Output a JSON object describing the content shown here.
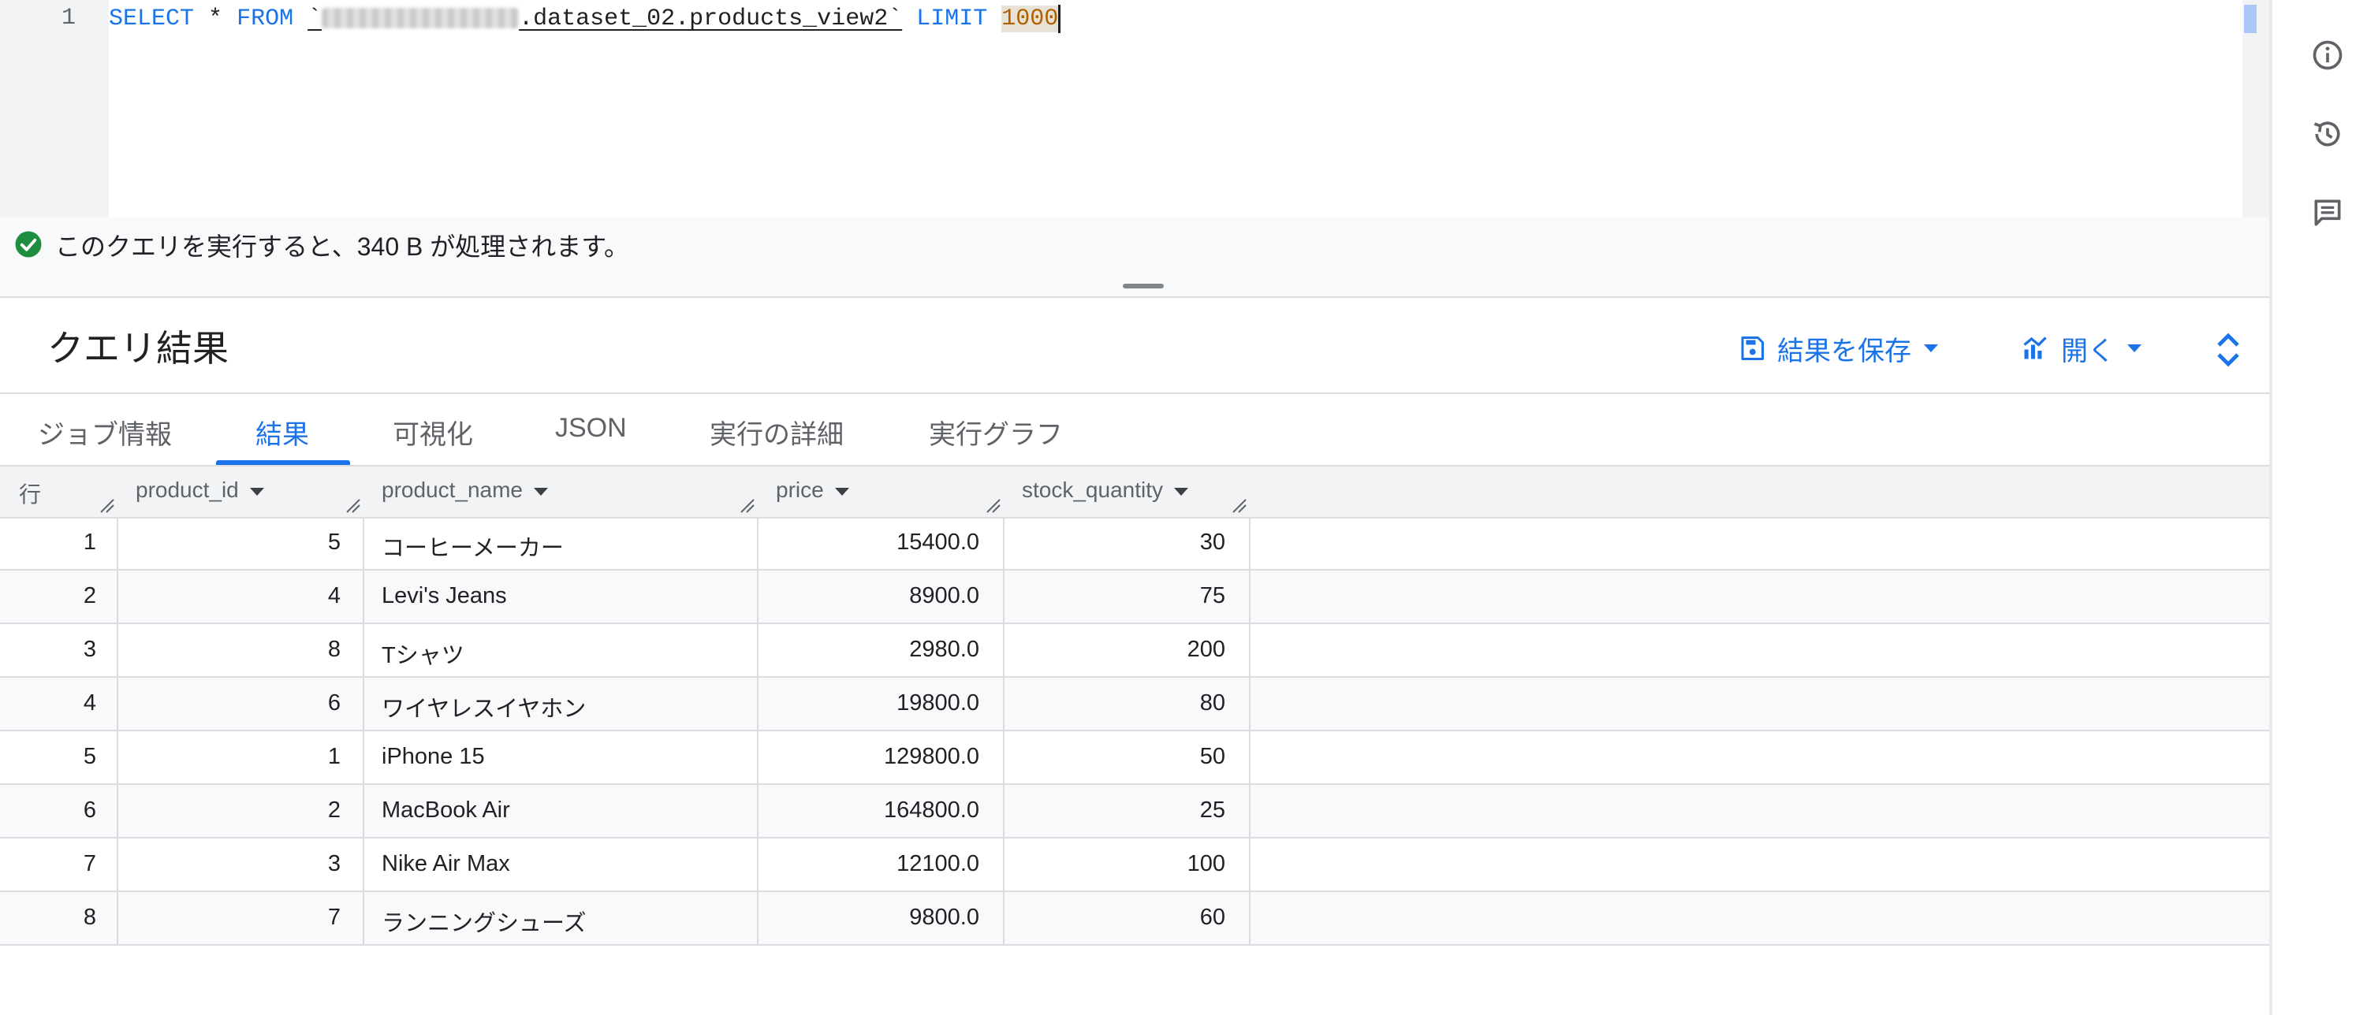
{
  "editor": {
    "line_number": "1",
    "kw_select": "SELECT",
    "star": "*",
    "kw_from": "FROM",
    "table_ref_suffix": ".dataset_02.products_view2`",
    "kw_limit": "LIMIT",
    "limit_value": "1000"
  },
  "status": {
    "message": "このクエリを実行すると、340 B が処理されます。"
  },
  "results": {
    "title": "クエリ結果",
    "save_label": "結果を保存",
    "open_label": "開く"
  },
  "tabs": [
    {
      "label": "ジョブ情報"
    },
    {
      "label": "結果"
    },
    {
      "label": "可視化"
    },
    {
      "label": "JSON"
    },
    {
      "label": "実行の詳細"
    },
    {
      "label": "実行グラフ"
    }
  ],
  "table": {
    "headers": [
      "行",
      "product_id",
      "product_name",
      "price",
      "stock_quantity"
    ],
    "rows": [
      [
        "1",
        "5",
        "コーヒーメーカー",
        "15400.0",
        "30"
      ],
      [
        "2",
        "4",
        "Levi's Jeans",
        "8900.0",
        "75"
      ],
      [
        "3",
        "8",
        "Tシャツ",
        "2980.0",
        "200"
      ],
      [
        "4",
        "6",
        "ワイヤレスイヤホン",
        "19800.0",
        "80"
      ],
      [
        "5",
        "1",
        "iPhone 15",
        "129800.0",
        "50"
      ],
      [
        "6",
        "2",
        "MacBook Air",
        "164800.0",
        "25"
      ],
      [
        "7",
        "3",
        "Nike Air Max",
        "12100.0",
        "100"
      ],
      [
        "8",
        "7",
        "ランニングシューズ",
        "9800.0",
        "60"
      ]
    ]
  },
  "colors": {
    "accent": "#1a73e8",
    "success": "#1e8e3e",
    "number_literal": "#b06000"
  },
  "icons": [
    "info-icon",
    "history-icon",
    "comment-icon",
    "check-circle-icon",
    "save-icon",
    "chart-icon",
    "expand-icon"
  ]
}
